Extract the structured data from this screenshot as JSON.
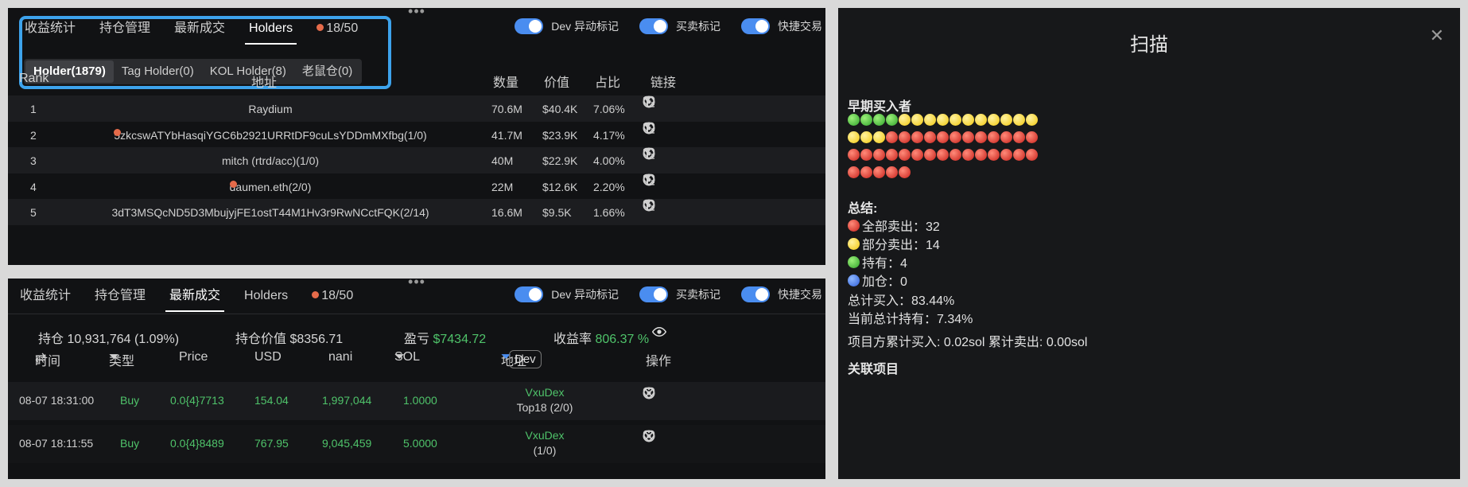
{
  "top_panel": {
    "tabs": [
      {
        "label": "收益统计",
        "active": false
      },
      {
        "label": "持仓管理",
        "active": false
      },
      {
        "label": "最新成交",
        "active": false
      },
      {
        "label": "Holders",
        "active": true
      },
      {
        "label": "18/50",
        "active": false
      }
    ],
    "toggles": [
      {
        "label": "Dev 异动标记",
        "on": true
      },
      {
        "label": "买卖标记",
        "on": true
      },
      {
        "label": "快捷交易",
        "on": true
      }
    ],
    "subtabs": [
      {
        "label": "Holder(1879)",
        "active": true
      },
      {
        "label": "Tag Holder(0)",
        "active": false
      },
      {
        "label": "KOL Holder(8)",
        "active": false
      },
      {
        "label": "老鼠仓(0)",
        "active": false
      }
    ],
    "columns": {
      "rank": "Rank",
      "address": "地址",
      "amount": "数量",
      "value": "价值",
      "share": "占比",
      "links": "链接"
    },
    "rows": [
      {
        "rank": "1",
        "address": "Raydium",
        "avatar": false,
        "amount": "70.6M",
        "value": "$40.4K",
        "share": "7.06%"
      },
      {
        "rank": "2",
        "address": "5zkcswATYbHasqiYGC6b2921URRtDF9cuLsYDDmMXfbg(1/0)",
        "avatar": true,
        "amount": "41.7M",
        "value": "$23.9K",
        "share": "4.17%"
      },
      {
        "rank": "3",
        "address": "mitch (rtrd/acc)(1/0)",
        "avatar": false,
        "amount": "40M",
        "value": "$22.9K",
        "share": "4.00%"
      },
      {
        "rank": "4",
        "address": "daumen.eth(2/0)",
        "avatar": true,
        "amount": "22M",
        "value": "$12.6K",
        "share": "2.20%"
      },
      {
        "rank": "5",
        "address": "3dT3MSQcND5D3MbujyjFE1ostT44M1Hv3r9RwNCctFQK(2/14)",
        "avatar": false,
        "amount": "16.6M",
        "value": "$9.5K",
        "share": "1.66%"
      }
    ]
  },
  "bottom_panel": {
    "tabs": [
      {
        "label": "收益统计",
        "active": false
      },
      {
        "label": "持仓管理",
        "active": false
      },
      {
        "label": "最新成交",
        "active": true
      },
      {
        "label": "Holders",
        "active": false
      },
      {
        "label": "18/50",
        "active": false
      }
    ],
    "toggles": [
      {
        "label": "Dev 异动标记",
        "on": true
      },
      {
        "label": "买卖标记",
        "on": true
      },
      {
        "label": "快捷交易",
        "on": true
      }
    ],
    "stats": {
      "holding_label": "持仓",
      "holding_value": "10,931,764 (1.09%)",
      "holding_value_label": "持仓价值",
      "holding_value_amount": "$8356.71",
      "pnl_label": "盈亏",
      "pnl_value": "$7434.72",
      "yield_label": "收益率",
      "yield_value": "806.37 %"
    },
    "columns": {
      "time": "时间",
      "type": "类型",
      "price": "Price",
      "usd": "USD",
      "token": "nani",
      "sol": "SOL",
      "address": "地址",
      "dev": "Dev",
      "actions": "操作"
    },
    "rows": [
      {
        "time": "08-07 18:31:00",
        "type": "Buy",
        "price": "0.0{4}7713",
        "usd": "154.04",
        "token": "1,997,044",
        "sol": "1.0000",
        "addr1": "VxuDex",
        "addr2": "Top18 (2/0)"
      },
      {
        "time": "08-07 18:11:55",
        "type": "Buy",
        "price": "0.0{4}8489",
        "usd": "767.95",
        "token": "9,045,459",
        "sol": "5.0000",
        "addr1": "VxuDex",
        "addr2": "(1/0)"
      }
    ]
  },
  "scan_panel": {
    "title": "扫描",
    "early_buyers_label": "早期买入者",
    "dot_rows": [
      [
        "g",
        "g",
        "g",
        "g",
        "y",
        "y",
        "y",
        "y",
        "y",
        "y",
        "y",
        "y",
        "y",
        "y",
        "y"
      ],
      [
        "y",
        "y",
        "y",
        "r",
        "r",
        "r",
        "r",
        "r",
        "r",
        "r",
        "r",
        "r",
        "r",
        "r",
        "r"
      ],
      [
        "r",
        "r",
        "r",
        "r",
        "r",
        "r",
        "r",
        "r",
        "r",
        "r",
        "r",
        "r",
        "r",
        "r",
        "r"
      ],
      [
        "r",
        "r",
        "r",
        "r",
        "r"
      ]
    ],
    "summary_label": "总结:",
    "summary": [
      {
        "dot": "r",
        "text": "全部卖出：32"
      },
      {
        "dot": "y",
        "text": "部分卖出：14"
      },
      {
        "dot": "g",
        "text": "持有：4"
      },
      {
        "dot": "b",
        "text": "加仓：0"
      }
    ],
    "total_buy": "总计买入：83.44%",
    "current_hold": "当前总计持有：7.34%",
    "project_line": "项目方累计买入: 0.02sol 累计卖出: 0.00sol",
    "related_label": "关联项目"
  },
  "colors": {
    "accent": "#4a8df0",
    "green": "#4fc36a",
    "highlight": "#3da3ec",
    "bg": "#111214"
  }
}
